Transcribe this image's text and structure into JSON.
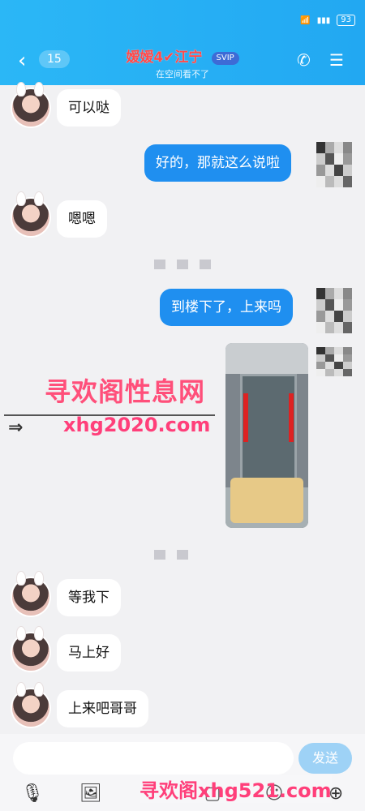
{
  "header": {
    "back_icon": "chevron-left-icon",
    "badge": "15",
    "title": "嫒嫒4✔江宁",
    "vip": "SVIP",
    "subtitle": "在空间看不了",
    "phone_icon": "phone-icon",
    "menu_icon": "menu-icon",
    "battery": "93"
  },
  "messages": [
    {
      "side": "left",
      "text": "可以哒"
    },
    {
      "side": "right",
      "text": "好的，那就这么说啦"
    },
    {
      "side": "left",
      "text": "嗯嗯"
    },
    {
      "side": "right",
      "text": "到楼下了，上来吗"
    },
    {
      "side": "left",
      "text": "等我下"
    },
    {
      "side": "left",
      "text": "马上好"
    },
    {
      "side": "left",
      "text": "上来吧哥哥"
    }
  ],
  "watermark": {
    "line1": "寻欢阁性息网",
    "line2": "xhg2020.com",
    "line3": "寻欢阁xhg521.com"
  },
  "composer": {
    "send_label": "发送"
  },
  "toolbar": {
    "icons": [
      "mic-icon",
      "image-icon",
      "camera-icon",
      "emoji-icon",
      "plus-icon"
    ]
  }
}
